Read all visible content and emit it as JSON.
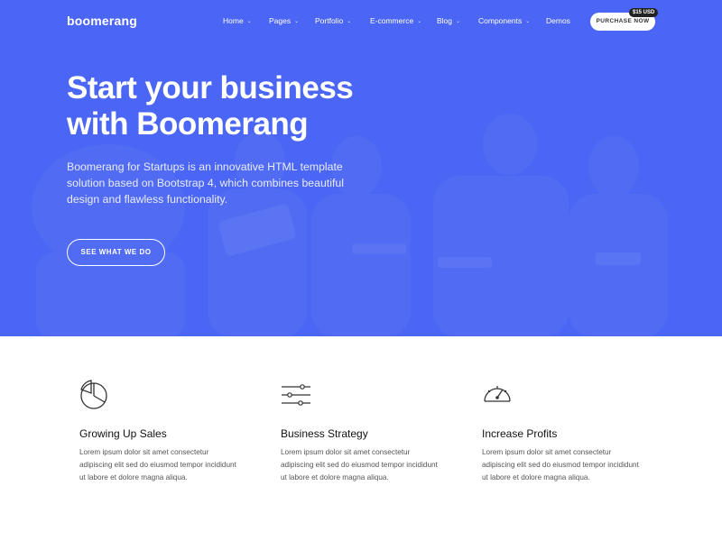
{
  "brand": {
    "logo": "boomerang"
  },
  "nav": {
    "items": [
      {
        "label": "Home"
      },
      {
        "label": "Pages"
      },
      {
        "label": "Portfolio"
      },
      {
        "label": "E-commerce"
      },
      {
        "label": "Blog"
      },
      {
        "label": "Components"
      },
      {
        "label": "Demos"
      }
    ],
    "purchase_label": "PURCHASE NOW",
    "price_badge": "$15 USD"
  },
  "hero": {
    "title_line1": "Start your business",
    "title_line2": "with Boomerang",
    "description": "Boomerang for Startups is an innovative HTML template solution based on Bootstrap 4, which combines beautiful design and flawless functionality.",
    "cta_label": "SEE WHAT WE DO"
  },
  "features": [
    {
      "icon": "pie-chart-icon",
      "title": "Growing Up Sales",
      "text": "Lorem ipsum dolor sit amet consectetur adipiscing elit sed do eiusmod tempor incididunt ut labore et dolore magna aliqua."
    },
    {
      "icon": "sliders-icon",
      "title": "Business Strategy",
      "text": "Lorem ipsum dolor sit amet consectetur adipiscing elit sed do eiusmod tempor incididunt ut labore et dolore magna aliqua."
    },
    {
      "icon": "speedometer-icon",
      "title": "Increase Profits",
      "text": "Lorem ipsum dolor sit amet consectetur adipiscing elit sed do eiusmod tempor incididunt ut labore et dolore magna aliqua."
    }
  ],
  "colors": {
    "hero_bg": "#4b67f5",
    "white": "#ffffff",
    "text_dark": "#111111",
    "text_muted": "#555555"
  }
}
